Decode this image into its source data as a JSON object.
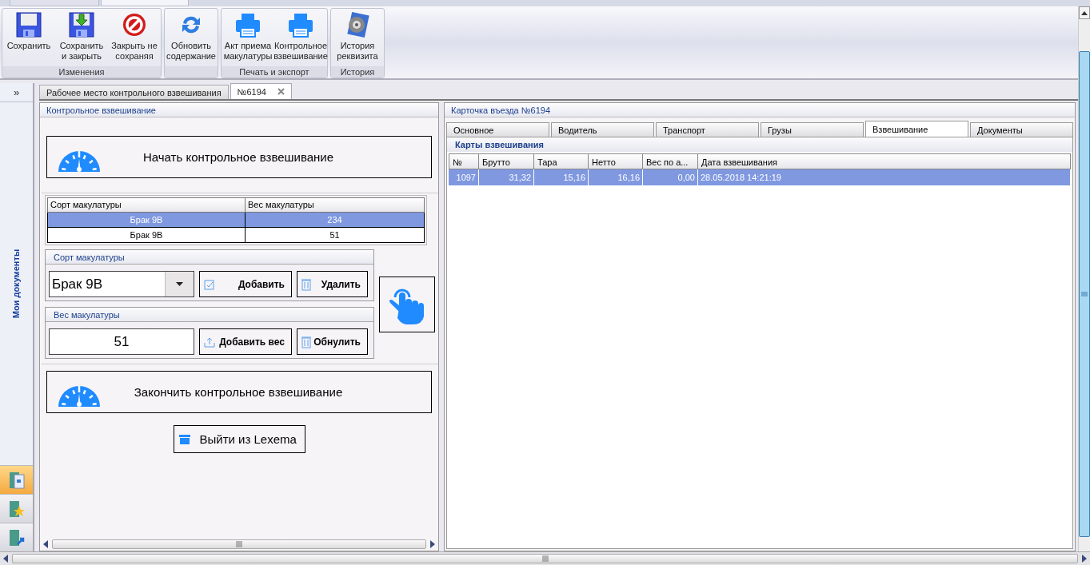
{
  "ribbon": {
    "top_tabs": [
      {
        "selected": false
      },
      {
        "selected": true
      }
    ],
    "groups": [
      {
        "label": "Изменения",
        "buttons": [
          {
            "kind": "save",
            "label": "Сохранить"
          },
          {
            "kind": "save-close",
            "label": "Сохранить и закрыть"
          },
          {
            "kind": "cancel",
            "label": "Закрыть не сохраняя"
          }
        ]
      },
      {
        "buttons": [
          {
            "kind": "refresh",
            "label": "Обновить содержание"
          }
        ]
      },
      {
        "label": "Печать и экспорт",
        "buttons": [
          {
            "kind": "print",
            "label": "Акт приема макулатуры"
          },
          {
            "kind": "print",
            "label": "Контрольное взвешивание"
          }
        ]
      },
      {
        "label": "История",
        "buttons": [
          {
            "kind": "history",
            "label": "История реквизита"
          }
        ]
      }
    ]
  },
  "navigation": {
    "expand_button": "»",
    "title": "Мои документы",
    "items": [
      {
        "kind": "documents",
        "selected": true
      },
      {
        "kind": "favorites",
        "selected": false
      },
      {
        "kind": "shortcut",
        "selected": false
      }
    ]
  },
  "document_tabs": [
    {
      "label": "Рабочее место контрольного взвешивания",
      "selected": false,
      "closable": false
    },
    {
      "label": "№6194",
      "selected": true,
      "closable": true
    }
  ],
  "left_panel": {
    "title": "Контрольное взвешивание",
    "start_button": "Начать контрольное взвешивание",
    "grade_table": {
      "columns": [
        "Сорт макулатуры",
        "Вес макулатуры"
      ],
      "rows": [
        {
          "cells": [
            "Брак 9В",
            "234"
          ],
          "selected": true
        },
        {
          "cells": [
            "Брак 9В",
            "51"
          ],
          "selected": false
        }
      ]
    },
    "grade_group": {
      "title": "Сорт макулатуры",
      "value": "Брак 9В",
      "add_button": "Добавить",
      "delete_button": "Удалить"
    },
    "weight_group": {
      "title": "Вес  макулатуры",
      "value": "51",
      "add_button": "Добавить вес",
      "reset_button": "Обнулить"
    },
    "finish_button": "Закончить контрольное взвешивание",
    "exit_button": "Выйти из Lexema"
  },
  "right_panel": {
    "title": "Карточка въезда №6194",
    "tabs": [
      {
        "label": "Основное",
        "selected": false
      },
      {
        "label": "Водитель",
        "selected": false
      },
      {
        "label": "Транспорт",
        "selected": false
      },
      {
        "label": "Грузы",
        "selected": false
      },
      {
        "label": "Взвешивание",
        "selected": true
      },
      {
        "label": "Документы",
        "selected": false
      }
    ],
    "section_title": "Карты взвешивания",
    "table": {
      "columns": [
        "№",
        "Брутто",
        "Тара",
        "Нетто",
        "Вес по а...",
        "Дата взвешивания"
      ],
      "rows": [
        {
          "cells": [
            "1097",
            "31,32",
            "15,16",
            "16,16",
            "0,00",
            "28.05.2018 14:21:19"
          ],
          "selected": true
        }
      ]
    }
  }
}
